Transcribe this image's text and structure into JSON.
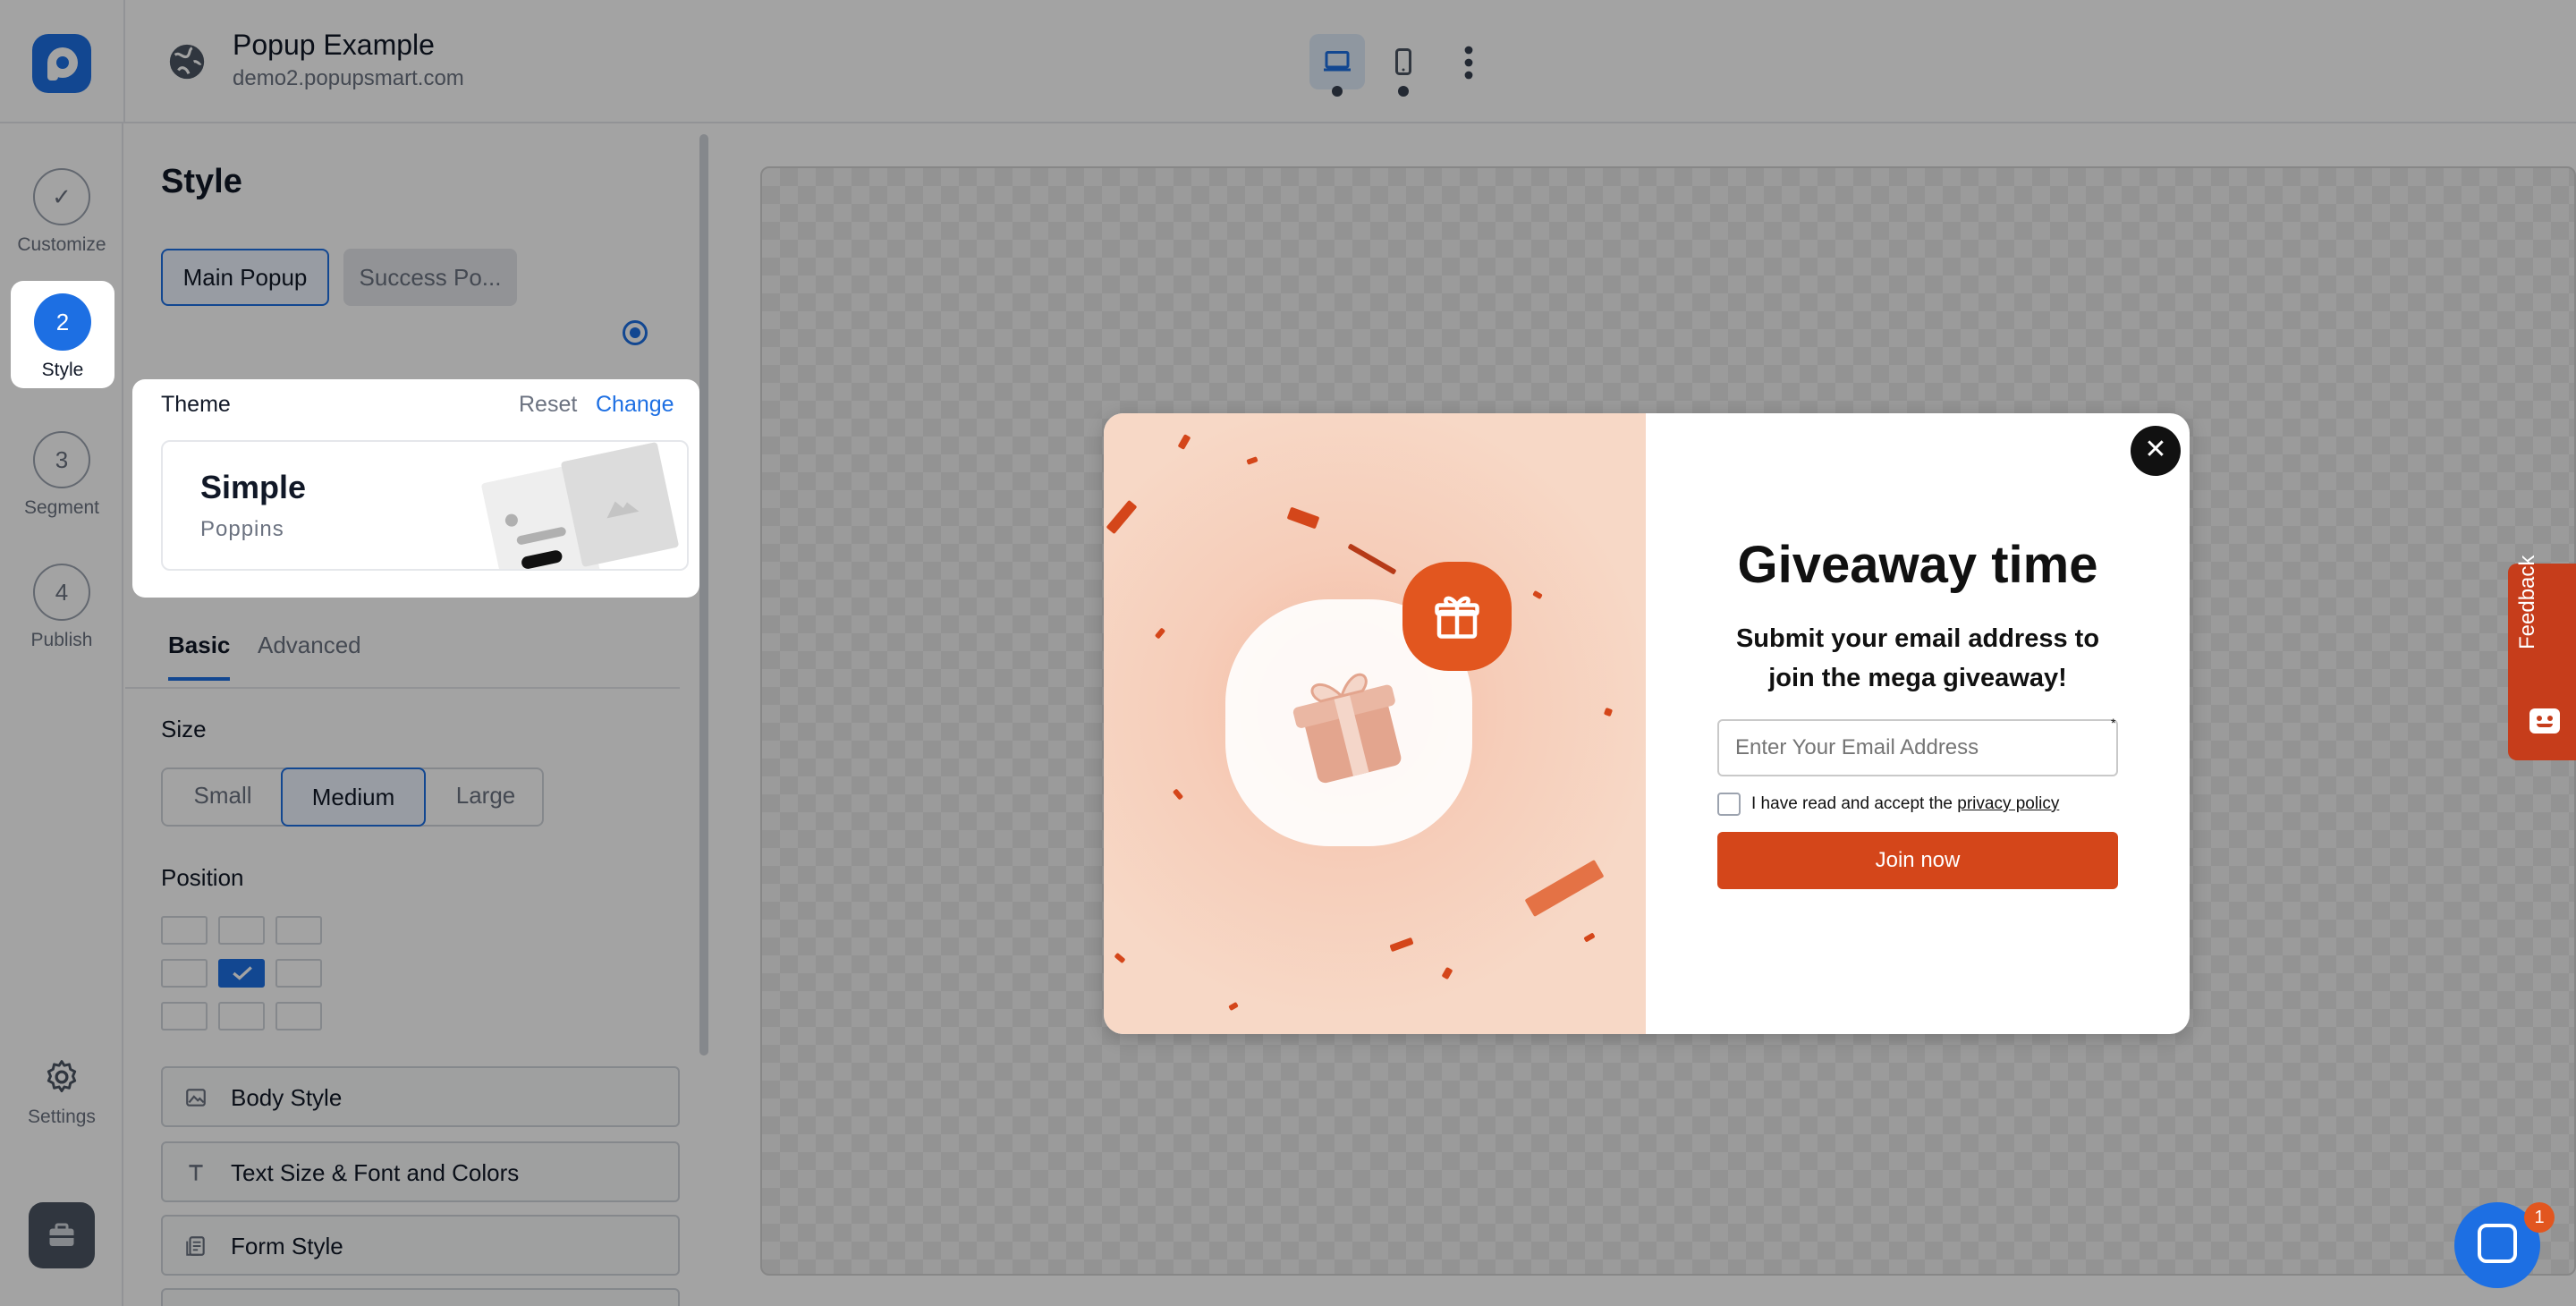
{
  "app": {
    "title": "Popup Example",
    "domain": "demo2.popupsmart.com",
    "colors": {
      "accent": "#1d6fe3",
      "brand_orange": "#d4461a",
      "feedback": "#c63d1b"
    }
  },
  "device_toggle": {
    "selected": "desktop",
    "options": [
      "desktop",
      "mobile"
    ]
  },
  "steps": [
    {
      "number": "1",
      "label": "Customize",
      "state": "done"
    },
    {
      "number": "2",
      "label": "Style",
      "state": "active"
    },
    {
      "number": "3",
      "label": "Segment",
      "state": "pending"
    },
    {
      "number": "4",
      "label": "Publish",
      "state": "pending"
    }
  ],
  "settings_label": "Settings",
  "panel": {
    "title": "Style",
    "tabs": [
      "Main Popup",
      "Success Po..."
    ],
    "selected_tab": "Main Popup",
    "theme": {
      "label": "Theme",
      "reset_label": "Reset",
      "change_label": "Change",
      "name": "Simple",
      "font": "Poppins"
    },
    "sub_tabs": [
      "Basic",
      "Advanced"
    ],
    "selected_sub_tab": "Basic",
    "size": {
      "label": "Size",
      "options": [
        "Small",
        "Medium",
        "Large"
      ],
      "selected": "Medium"
    },
    "position": {
      "label": "Position",
      "selected_row": 2,
      "selected_col": 2
    },
    "accordions": [
      {
        "label": "Body Style",
        "icon": "image-icon"
      },
      {
        "label": "Text Size & Font and Colors",
        "icon": "text-icon"
      },
      {
        "label": "Form Style",
        "icon": "form-icon"
      }
    ]
  },
  "popup": {
    "title": "Giveaway time",
    "subtitle": "Submit your email address to join the mega giveaway!",
    "email_placeholder": "Enter Your Email Address",
    "required_mark": "*",
    "consent_prefix": "I have read and accept the",
    "consent_link": "privacy policy",
    "button_label": "Join now",
    "close_glyph": "✕"
  },
  "feedback_label": "Feedback",
  "chat_badge_count": "1"
}
